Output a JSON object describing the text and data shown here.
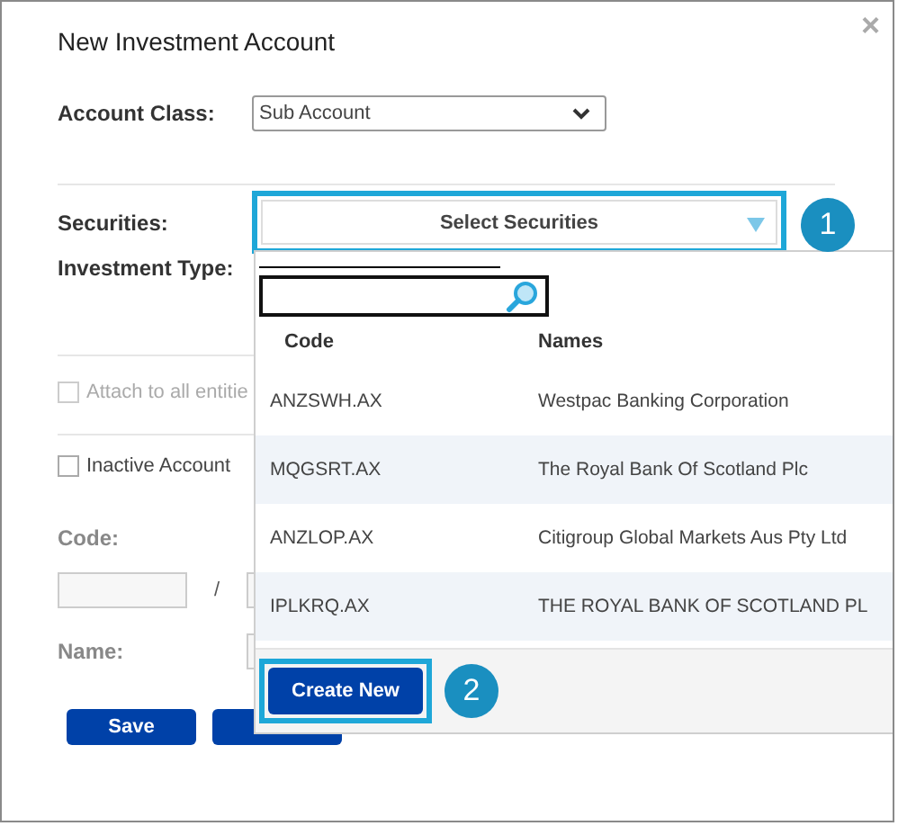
{
  "dialog": {
    "title": "New Investment Account",
    "close": "×"
  },
  "form": {
    "account_class": {
      "label": "Account Class:",
      "value": "Sub Account"
    },
    "securities": {
      "label": "Securities:",
      "value": "Select Securities"
    },
    "investment_type": {
      "label": "Investment Type:"
    },
    "checkboxes": [
      {
        "label": "Attach to all entitie",
        "checked": false,
        "disabled": true
      },
      {
        "label": "Inactive Account",
        "checked": false,
        "disabled": false
      }
    ],
    "code": {
      "label": "Code:",
      "separator": "/"
    },
    "name": {
      "label": "Name:"
    }
  },
  "buttons": [
    {
      "label": "Save"
    }
  ],
  "dropdown": {
    "columns": [
      "Code",
      "Names"
    ],
    "rows": [
      {
        "code": "ANZSWH.AX",
        "name": "Westpac Banking Corporation"
      },
      {
        "code": "MQGSRT.AX",
        "name": "The Royal Bank Of Scotland Plc"
      },
      {
        "code": "ANZLOP.AX",
        "name": "Citigroup Global Markets Aus Pty Ltd"
      },
      {
        "code": "IPLKRQ.AX",
        "name": "THE ROYAL BANK OF SCOTLAND PL"
      }
    ],
    "button": "Create New"
  },
  "callouts": [
    "1",
    "2"
  ]
}
